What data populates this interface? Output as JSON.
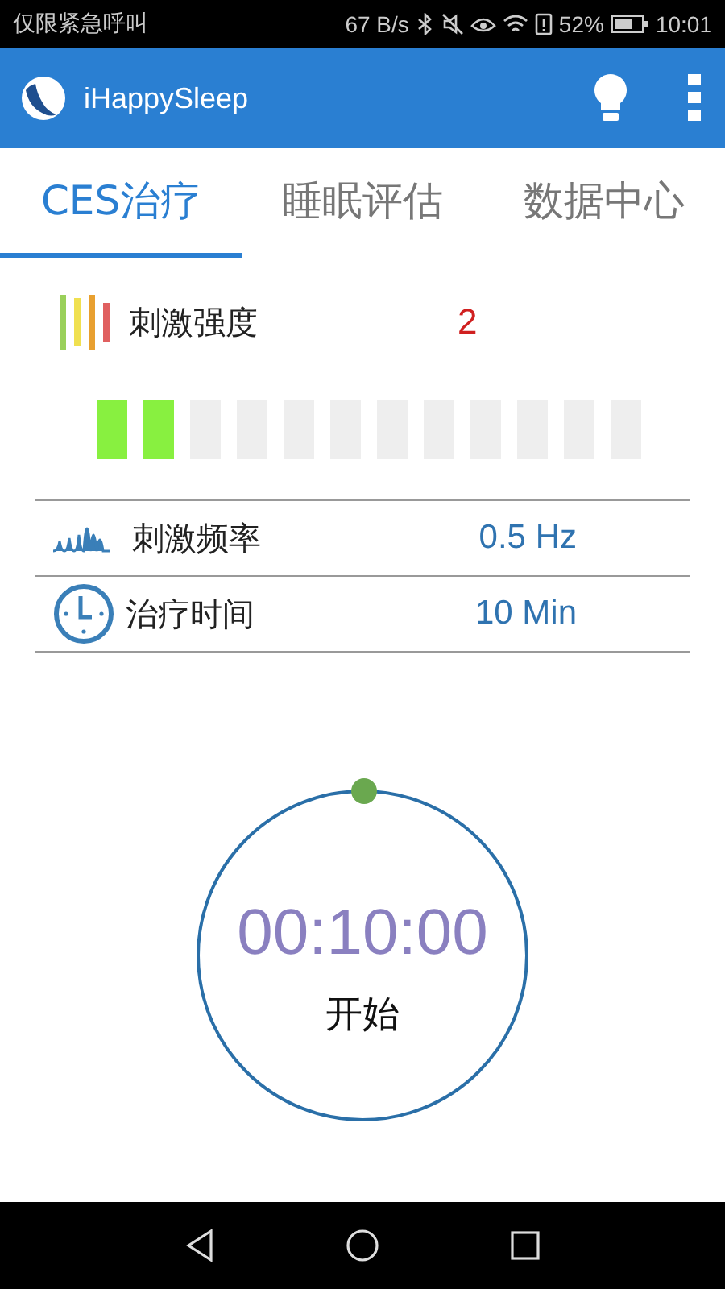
{
  "status_bar": {
    "carrier": "仅限紧急呼叫",
    "speed": "67 B/s",
    "battery": "52%",
    "time": "10:01"
  },
  "app_bar": {
    "title": "iHappySleep"
  },
  "tabs": [
    {
      "label": "CES治疗",
      "selected": true
    },
    {
      "label": "睡眠评估",
      "selected": false
    },
    {
      "label": "数据中心",
      "selected": false
    }
  ],
  "intensity": {
    "label": "刺激强度",
    "value": "2",
    "segments": [
      {
        "on": true
      },
      {
        "on": true
      },
      {
        "on": false
      },
      {
        "on": false
      },
      {
        "on": false
      },
      {
        "on": false
      },
      {
        "on": false
      },
      {
        "on": false
      },
      {
        "on": false
      },
      {
        "on": false
      },
      {
        "on": false
      },
      {
        "on": false
      }
    ]
  },
  "settings": [
    {
      "kind": "wave",
      "label": "刺激频率",
      "value": "0.5 Hz"
    },
    {
      "kind": "clock",
      "label": "治疗时间",
      "value": "10 Min"
    }
  ],
  "timer": {
    "time": "00:10:00",
    "button": "开始"
  }
}
